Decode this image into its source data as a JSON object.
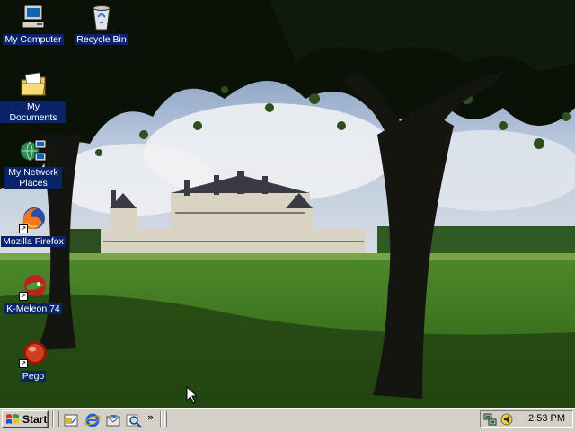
{
  "desktop": {
    "icons": [
      {
        "label": "My Computer"
      },
      {
        "label": "Recycle Bin"
      },
      {
        "label": "My Documents"
      },
      {
        "label": "My Network Places"
      },
      {
        "label": "Mozilla Firefox"
      },
      {
        "label": "K-Meleon 74"
      },
      {
        "label": "Pego"
      }
    ],
    "selection_color": "#0a246a"
  },
  "taskbar": {
    "start_label": "Start",
    "quick_launch": [
      "show-desktop-icon",
      "internet-explorer-icon",
      "outlook-express-icon",
      "search-icon"
    ],
    "chevron": "»",
    "tray_icons": [
      "network-connection-icon",
      "volume-icon"
    ],
    "clock": "2:53 PM",
    "color": "#d4d0c8"
  }
}
